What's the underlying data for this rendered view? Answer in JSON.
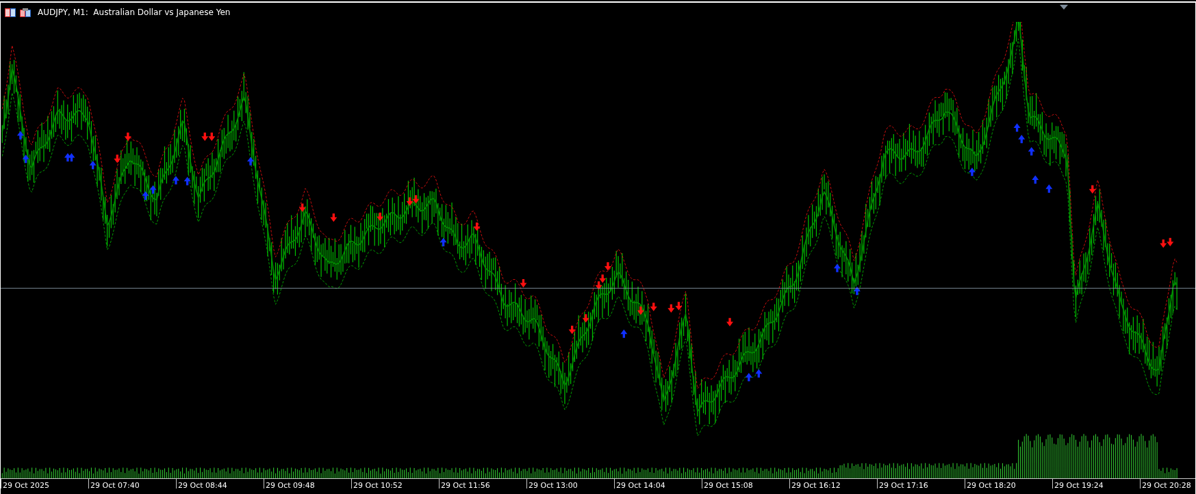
{
  "chart_window": {
    "title": "AUDJPY, M1:  Australian Dollar vs Japanese Yen",
    "time_axis": {
      "labels": [
        "29 Oct 2025",
        "29 Oct 07:40",
        "29 Oct 08:44",
        "29 Oct 09:48",
        "29 Oct 10:52",
        "29 Oct 11:56",
        "29 Oct 13:00",
        "29 Oct 14:04",
        "29 Oct 15:08",
        "29 Oct 16:12",
        "29 Oct 17:16",
        "29 Oct 18:20",
        "29 Oct 19:24",
        "29 Oct 20:28"
      ]
    }
  }
}
